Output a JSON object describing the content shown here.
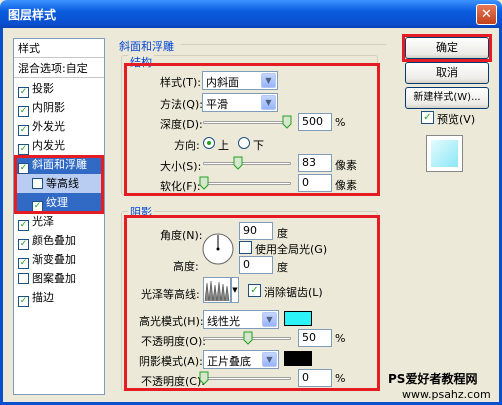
{
  "window": {
    "title": "图层样式",
    "close": "✕"
  },
  "stylelist": {
    "header": "样式",
    "blend": "混合选项:自定",
    "items": [
      {
        "label": "投影",
        "checked": true
      },
      {
        "label": "内阴影",
        "checked": true
      },
      {
        "label": "外发光",
        "checked": true
      },
      {
        "label": "内发光",
        "checked": true
      },
      {
        "label": "斜面和浮雕",
        "checked": true
      },
      {
        "label": "等高线",
        "checked": false
      },
      {
        "label": "纹理",
        "checked": true
      },
      {
        "label": "光泽",
        "checked": true
      },
      {
        "label": "颜色叠加",
        "checked": true
      },
      {
        "label": "渐变叠加",
        "checked": true
      },
      {
        "label": "图案叠加",
        "checked": false
      },
      {
        "label": "描边",
        "checked": true
      }
    ],
    "check_glyph": "✓"
  },
  "bevel": {
    "title": "斜面和浮雕",
    "structure_title": "结构",
    "style_label": "样式(T):",
    "style_value": "内斜面",
    "technique_label": "方法(Q):",
    "technique_value": "平滑",
    "depth_label": "深度(D):",
    "depth_value": "500",
    "depth_unit": "%",
    "direction_label": "方向:",
    "dir_up": "上",
    "dir_down": "下",
    "size_label": "大小(S):",
    "size_value": "83",
    "size_unit": "像素",
    "soften_label": "软化(F):",
    "soften_value": "0",
    "soften_unit": "像素"
  },
  "shading": {
    "title": "阴影",
    "angle_label": "角度(N):",
    "angle_value": "90",
    "angle_unit": "度",
    "global_light_label": "使用全局光(G)",
    "altitude_label": "高度:",
    "altitude_value": "0",
    "altitude_unit": "度",
    "gloss_label": "光泽等高线:",
    "antialias_label": "消除锯齿(L)",
    "highlight_mode_label": "高光模式(H):",
    "highlight_mode_value": "线性光",
    "highlight_color": "#2cf3f8",
    "highlight_opacity_label": "不透明度(O):",
    "highlight_opacity_value": "50",
    "shadow_mode_label": "阴影模式(A):",
    "shadow_mode_value": "正片叠底",
    "shadow_color": "#000000",
    "shadow_opacity_label": "不透明度(C):",
    "shadow_opacity_value": "0",
    "pct": "%"
  },
  "buttons": {
    "ok": "确定",
    "cancel": "取消",
    "new_style": "新建样式(W)...",
    "preview": "预览(V)"
  },
  "watermark": {
    "line1": "PS爱好者教程网",
    "line2": "www.psahz.com"
  },
  "accent": "#e51c24"
}
